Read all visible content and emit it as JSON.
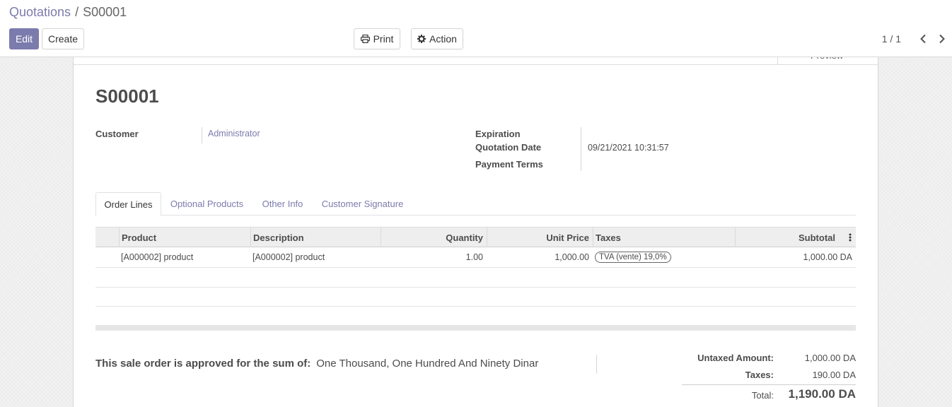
{
  "breadcrumb": {
    "parent": "Quotations",
    "separator": "/",
    "current": "S00001"
  },
  "toolbar": {
    "edit_label": "Edit",
    "create_label": "Create",
    "print_label": "Print",
    "action_label": "Action"
  },
  "pager": {
    "value": "1 / 1"
  },
  "sheet": {
    "preview_label": "Preview"
  },
  "record": {
    "name": "S00001",
    "customer_label": "Customer",
    "customer_value": "Administrator",
    "expiration_label": "Expiration",
    "quotation_date_label": "Quotation Date",
    "quotation_date_value": "09/21/2021 10:31:57",
    "payment_terms_label": "Payment Terms"
  },
  "tabs": [
    {
      "label": "Order Lines",
      "active": true
    },
    {
      "label": "Optional Products",
      "active": false
    },
    {
      "label": "Other Info",
      "active": false
    },
    {
      "label": "Customer Signature",
      "active": false
    }
  ],
  "table": {
    "headers": {
      "product": "Product",
      "description": "Description",
      "quantity": "Quantity",
      "unit_price": "Unit Price",
      "taxes": "Taxes",
      "subtotal": "Subtotal"
    },
    "rows": [
      {
        "product": "[A000002] product",
        "description": "[A000002] product",
        "quantity": "1.00",
        "unit_price": "1,000.00",
        "taxes": "TVA (vente) 19,0%",
        "subtotal": "1,000.00 DA"
      }
    ]
  },
  "summary": {
    "sum_label": "This sale order is approved for the sum of:",
    "sum_words": "One Thousand, One Hundred And Ninety Dinar",
    "untaxed_label": "Untaxed Amount:",
    "untaxed_value": "1,000.00 DA",
    "taxes_label": "Taxes:",
    "taxes_value": "190.00 DA",
    "total_label": "Total:",
    "total_value": "1,190.00 DA"
  },
  "colors": {
    "accent": "#7c7bad",
    "text": "#4c4c4c"
  }
}
